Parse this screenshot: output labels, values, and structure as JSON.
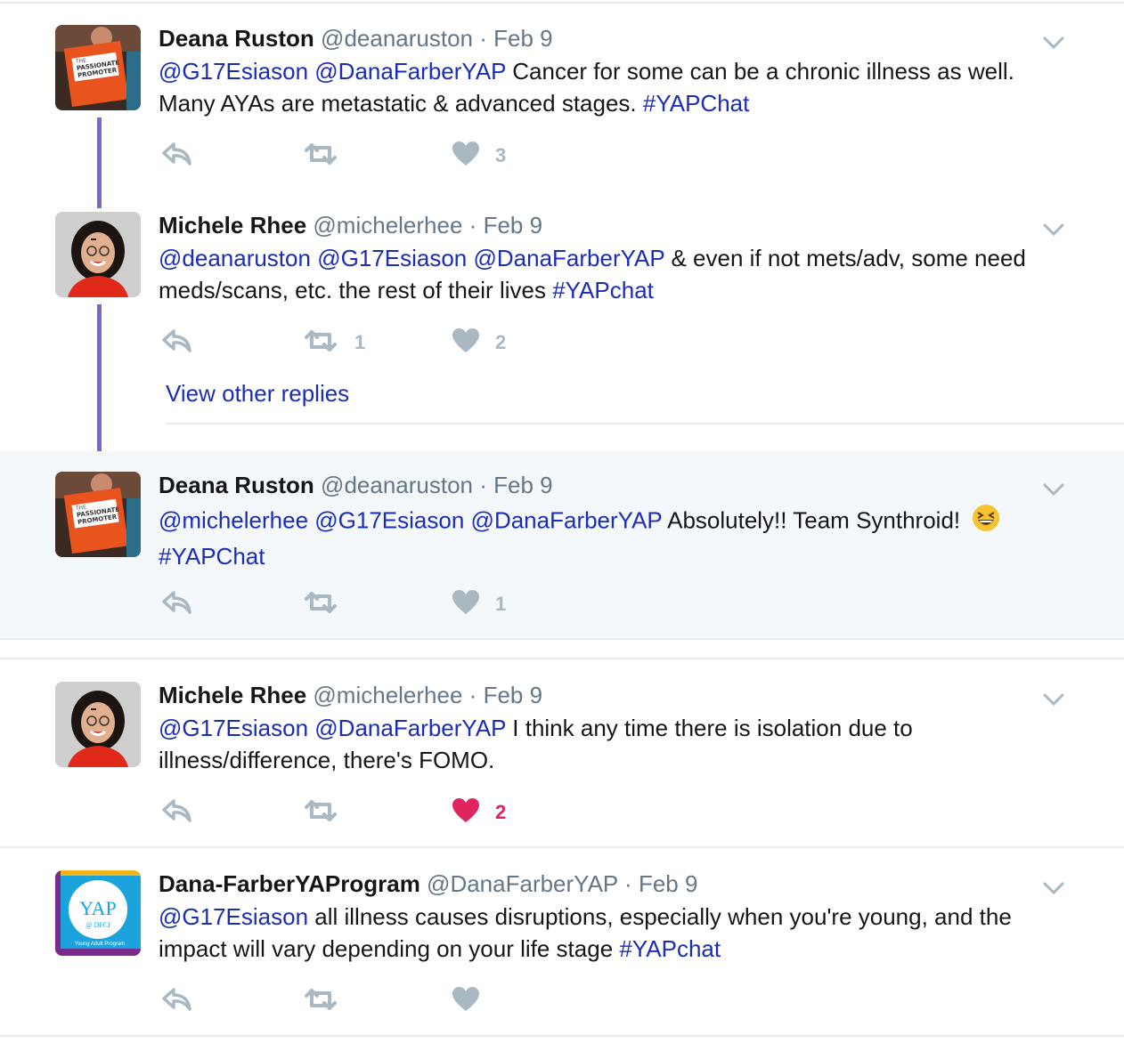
{
  "tweets": [
    {
      "name": "Deana Ruston",
      "handle": "@deanaruston",
      "dot": "·",
      "date": "Feb 9",
      "avatar": "deana-avatar",
      "text_parts": [
        {
          "t": "@G17Esiason",
          "link": true
        },
        {
          "t": " "
        },
        {
          "t": "@DanaFarberYAP",
          "link": true
        },
        {
          "t": " Cancer for some can be a chronic illness as well. Many AYAs are metastatic & advanced stages. "
        },
        {
          "t": "#YAPChat",
          "link": true
        }
      ],
      "retweets": "",
      "likes": "3",
      "liked": false
    },
    {
      "name": "Michele Rhee",
      "handle": "@michelerhee",
      "dot": "·",
      "date": "Feb 9",
      "avatar": "michele-avatar",
      "text_parts": [
        {
          "t": "@deanaruston",
          "link": true
        },
        {
          "t": " "
        },
        {
          "t": "@G17Esiason",
          "link": true
        },
        {
          "t": " "
        },
        {
          "t": "@DanaFarberYAP",
          "link": true
        },
        {
          "t": " & even if not mets/adv, some need meds/scans, etc. the rest of their lives "
        },
        {
          "t": "#YAPchat",
          "link": true
        }
      ],
      "retweets": "1",
      "likes": "2",
      "liked": false
    },
    {
      "name": "Deana Ruston",
      "handle": "@deanaruston",
      "dot": "·",
      "date": "Feb 9",
      "avatar": "deana-avatar",
      "text_parts": [
        {
          "t": "@michelerhee",
          "link": true
        },
        {
          "t": " "
        },
        {
          "t": "@G17Esiason",
          "link": true
        },
        {
          "t": " "
        },
        {
          "t": "@DanaFarberYAP",
          "link": true
        },
        {
          "t": " Absolutely!! Team Synthroid! "
        },
        {
          "emoji": "grinning-squinting-face"
        },
        {
          "t": " "
        },
        {
          "t": "#YAPChat",
          "link": true
        }
      ],
      "retweets": "",
      "likes": "1",
      "liked": false
    },
    {
      "name": "Michele Rhee",
      "handle": "@michelerhee",
      "dot": "·",
      "date": "Feb 9",
      "avatar": "michele-avatar",
      "text_parts": [
        {
          "t": "@G17Esiason",
          "link": true
        },
        {
          "t": " "
        },
        {
          "t": "@DanaFarberYAP",
          "link": true
        },
        {
          "t": " I think any time there is isolation due to illness/difference, there's FOMO."
        }
      ],
      "retweets": "",
      "likes": "2",
      "liked": true
    },
    {
      "name": "Dana-FarberYAProgram",
      "handle": "@DanaFarberYAP",
      "dot": "·",
      "date": "Feb 9",
      "avatar": "yap-avatar",
      "avatar_text": {
        "main": "YAP",
        "sub": "@ DFCI",
        "footer": "Young Adult Program"
      },
      "text_parts": [
        {
          "t": "@G17Esiason",
          "link": true
        },
        {
          "t": " all illness causes disruptions, especially when you're young, and the impact will vary depending on your life stage "
        },
        {
          "t": "#YAPchat",
          "link": true
        }
      ],
      "retweets": "",
      "likes": "",
      "liked": false
    }
  ],
  "view_other_replies": "View other replies",
  "icons": {
    "reply": "reply-icon",
    "retweet": "retweet-icon",
    "like": "heart-icon",
    "menu": "chevron-down-icon"
  },
  "colors": {
    "link": "#1b2db5",
    "thread": "#6c6fcf",
    "icon": "#aab8c2",
    "liked": "#e0245e",
    "highlight": "#f5f8fa"
  },
  "deana_avatar_sign": {
    "line1": "THE",
    "line2": "PASSIONATE",
    "line3": "PROMOTER"
  }
}
